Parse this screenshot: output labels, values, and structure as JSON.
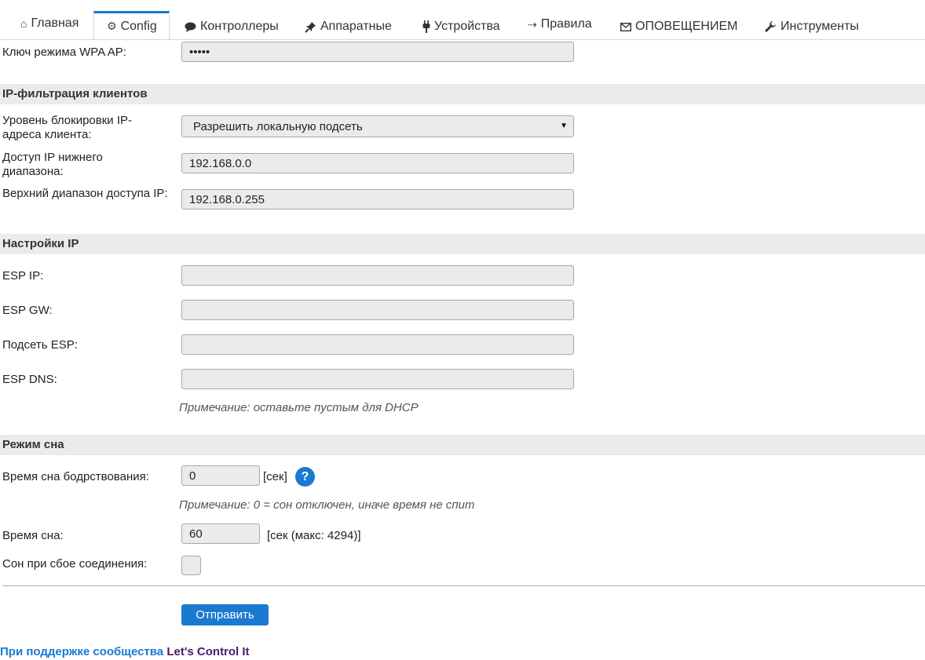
{
  "tabs": [
    {
      "label": "Главная",
      "icon": "home-icon"
    },
    {
      "label": "Config",
      "icon": "gear-icon",
      "active": true
    },
    {
      "label": "Контроллеры",
      "icon": "speech-bubble-icon"
    },
    {
      "label": "Аппаратные",
      "icon": "pushpin-icon"
    },
    {
      "label": "Устройства",
      "icon": "plug-icon"
    },
    {
      "label": "Правила",
      "icon": "arrow-icon"
    },
    {
      "label": "ОПОВЕЩЕНИЕМ",
      "icon": "envelope-icon"
    },
    {
      "label": "Инструменты",
      "icon": "wrench-icon"
    }
  ],
  "wpa": {
    "label": "Ключ режима WPA AP:",
    "value": "•••••"
  },
  "ip_filter": {
    "title": "IP-фильтрация клиентов",
    "block_level_label": "Уровень блокировки IP-адреса клиента:",
    "block_level_value": "Разрешить локальную подсеть",
    "low_range_label": "Доступ IP нижнего диапазона:",
    "low_range_value": "192.168.0.0",
    "high_range_label": "Верхний диапазон доступа IP:",
    "high_range_value": "192.168.0.255"
  },
  "ip_settings": {
    "title": "Настройки IP",
    "esp_ip_label": "ESP IP:",
    "esp_ip_value": "",
    "esp_gw_label": "ESP GW:",
    "esp_gw_value": "",
    "esp_subnet_label": "Подсеть ESP:",
    "esp_subnet_value": "",
    "esp_dns_label": "ESP DNS:",
    "esp_dns_value": "",
    "note": "Примечание: оставьте пустым для DHCP"
  },
  "sleep": {
    "title": "Режим сна",
    "awake_label": "Время сна бодрствования:",
    "awake_value": "0",
    "awake_unit": "[сек]",
    "help": "?",
    "awake_note": "Примечание: 0 = сон отключен, иначе время не спит",
    "sleep_label": "Время сна:",
    "sleep_value": "60",
    "sleep_unit": "[сек (макс: 4294)]",
    "on_fail_label": "Сон при сбое соединения:",
    "on_fail_checked": false
  },
  "submit_label": "Отправить",
  "footer": {
    "powered": "При поддержке сообщества",
    "brand": "Let's Control It"
  },
  "colors": {
    "accent": "#1a7ad1",
    "brand": "#4a1a6e",
    "field_bg": "#ebebeb"
  }
}
